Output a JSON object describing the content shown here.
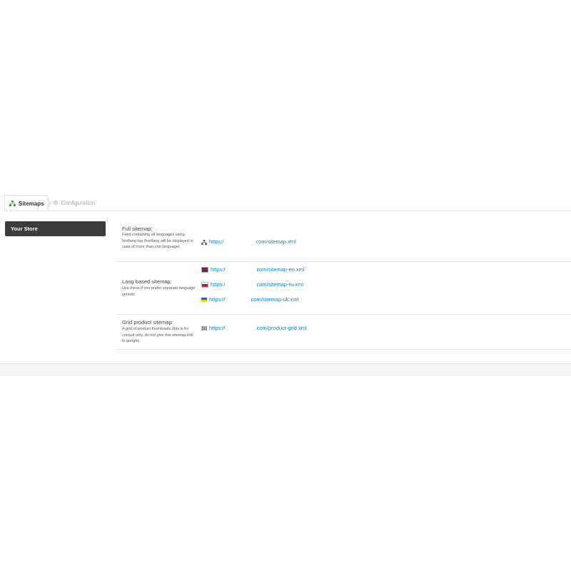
{
  "tabs": [
    {
      "label": "Sitemaps",
      "icon": "sitemap-icon",
      "active": true
    },
    {
      "label": "Configuration",
      "icon": "gear-icon",
      "active": false
    }
  ],
  "sidebar": {
    "store_label": "Your Store"
  },
  "sections": {
    "full": {
      "title": "Full sitemap:",
      "desc": "Feed containing all languages using hreflang tag (hreflang will be displayed in case of more than one language)",
      "link_prefix": "https:/",
      "link_suffix": "com/sitemap.xml"
    },
    "lang": {
      "title": "Lang based sitemap:",
      "desc": "Use these if you prefer separate language version",
      "links": [
        {
          "flag": "uk-flag-icon",
          "prefix": "https:/",
          "suffix": "com/sitemap-en.xml"
        },
        {
          "flag": "russia-flag-icon",
          "prefix": "https:/",
          "suffix": "com/sitemap-ru.xml"
        },
        {
          "flag": "ukraine-flag-icon",
          "prefix": "https://",
          "suffix": ".com/sitemap-uk.xml"
        }
      ]
    },
    "grid": {
      "title": "Grid product sitemap:",
      "desc": "A grid of product thumbnails (this is for consult only, do not give this sitemap link to google)",
      "link_prefix": "https://",
      "link_suffix": ".com/product-grid.xml"
    }
  },
  "colors": {
    "link": "#1a7fc1",
    "sidebar_bg": "#3d3d3d",
    "tab_icon": "#4a9b3a"
  }
}
